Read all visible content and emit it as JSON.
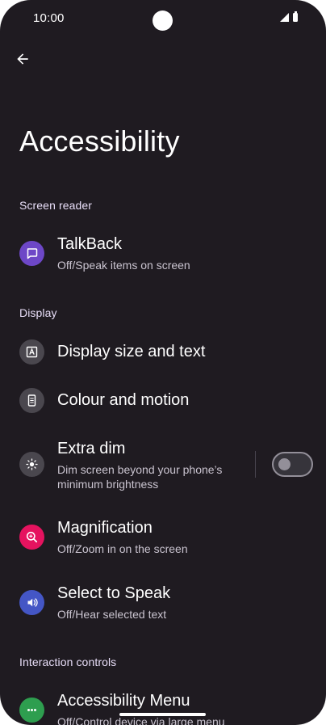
{
  "status_bar": {
    "time": "10:00"
  },
  "header": {
    "title": "Accessibility",
    "back_icon": "arrow-back-icon"
  },
  "sections": {
    "screen_reader": "Screen reader",
    "display": "Display",
    "interaction_controls": "Interaction controls"
  },
  "items": {
    "talkback": {
      "title": "TalkBack",
      "summary": "Off/Speak items on screen",
      "icon": "chat-bubble-icon",
      "icon_color": "#6d47c7"
    },
    "display_size": {
      "title": "Display size and text",
      "icon": "text-format-icon",
      "icon_color": "#4a474e"
    },
    "colour_motion": {
      "title": "Colour and motion",
      "icon": "phone-screen-icon",
      "icon_color": "#4a474e"
    },
    "extra_dim": {
      "title": "Extra dim",
      "summary_line1": "Dim screen beyond your phone’s",
      "summary_line2": "minimum brightness",
      "icon": "brightness-icon",
      "icon_color": "#4a474e",
      "toggle_on": false
    },
    "magnification": {
      "title": "Magnification",
      "summary": "Off/Zoom in on the screen",
      "icon": "zoom-in-icon",
      "icon_color": "#e5135f"
    },
    "select_to_speak": {
      "title": "Select to Speak",
      "summary": "Off/Hear selected text",
      "icon": "speaker-icon",
      "icon_color": "#4456c5"
    },
    "accessibility_menu": {
      "title": "Accessibility Menu",
      "summary": "Off/Control device via large menu",
      "icon": "more-dots-icon",
      "icon_color": "#2e9e4f"
    }
  }
}
